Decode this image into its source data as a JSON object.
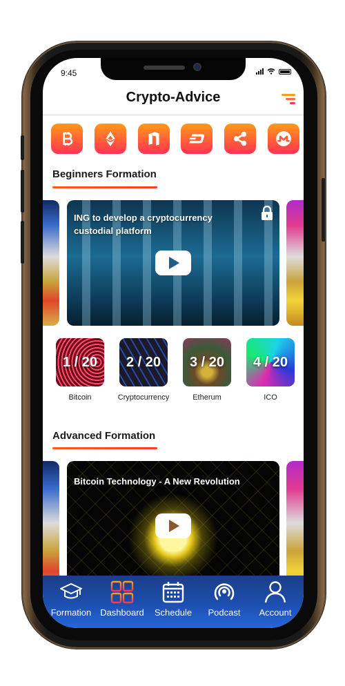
{
  "status_bar": {
    "time": "9:45"
  },
  "header": {
    "title": "Crypto-Advice",
    "menu_icon": "filter-menu-icon"
  },
  "coins": [
    {
      "name": "bitcoin",
      "icon": "bitcoin-icon"
    },
    {
      "name": "ethereum",
      "icon": "ethereum-icon"
    },
    {
      "name": "neo",
      "icon": "neo-icon"
    },
    {
      "name": "dash",
      "icon": "dash-icon"
    },
    {
      "name": "ripple",
      "icon": "ripple-icon"
    },
    {
      "name": "monero",
      "icon": "monero-icon"
    }
  ],
  "beginners": {
    "title": "Beginners Formation",
    "featured": {
      "title": "ING to develop a cryptocurrency custodial platform",
      "locked": true
    },
    "lessons": [
      {
        "progress": "1 / 20",
        "label": "Bitcoin"
      },
      {
        "progress": "2 / 20",
        "label": "Cryptocurrency"
      },
      {
        "progress": "3 / 20",
        "label": "Etherum"
      },
      {
        "progress": "4 / 20",
        "label": "ICO"
      }
    ]
  },
  "advanced": {
    "title": "Advanced Formation",
    "featured": {
      "title": "Bitcoin Technology - A New Revolution"
    }
  },
  "tabbar": {
    "active_index": 1,
    "tabs": [
      {
        "label": "Formation",
        "icon": "graduation-cap-icon"
      },
      {
        "label": "Dashboard",
        "icon": "grid-icon"
      },
      {
        "label": "Schedule",
        "icon": "calendar-icon"
      },
      {
        "label": "Podcast",
        "icon": "podcast-icon"
      },
      {
        "label": "Account",
        "icon": "user-icon"
      }
    ]
  },
  "colors": {
    "accent_orange": "#ff9a1a",
    "accent_red": "#ff3355",
    "tabbar_blue": "#1d4fb0"
  }
}
